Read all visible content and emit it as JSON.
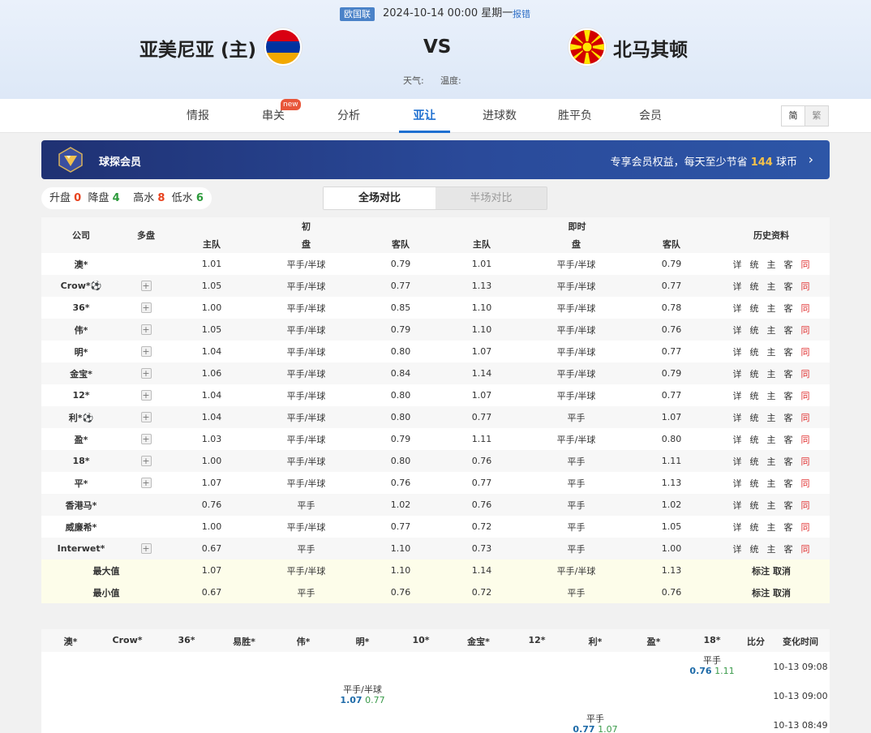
{
  "match": {
    "league": "欧国联",
    "datetime": "2024-10-14 00:00 星期一",
    "report_link": "报错",
    "home_team": "亚美尼亚 (主)",
    "away_team": "北马其顿",
    "vs": "VS",
    "weather_label": "天气:",
    "temp_label": "温度:"
  },
  "nav": {
    "tabs": [
      "情报",
      "串关",
      "分析",
      "亚让",
      "进球数",
      "胜平负",
      "会员"
    ],
    "active_tab": "亚让",
    "new_badge": "new",
    "lang_simplified": "简",
    "lang_traditional": "繁"
  },
  "banner": {
    "title": "球探会员",
    "promo_prefix": "专享会员权益，每天至少节省 ",
    "promo_number": "144",
    "promo_suffix": " 球币",
    "arrow": "›"
  },
  "stats": {
    "up_label": "升盘",
    "up": "0",
    "down_label": "降盘",
    "down": "4",
    "high_label": "高水",
    "high": "8",
    "low_label": "低水",
    "low": "6"
  },
  "toggle": {
    "full": "全场对比",
    "half": "半场对比"
  },
  "odds_table": {
    "headers": {
      "company": "公司",
      "multi": "多盘",
      "initial": "初",
      "live": "即时",
      "history": "历史资料",
      "home": "主队",
      "line": "盘",
      "away": "客队"
    },
    "history_links": [
      "详",
      "统",
      "主",
      "客",
      "同"
    ],
    "rows": [
      {
        "company": "澳*",
        "multi": false,
        "i_home": "1.01",
        "i_line": "平手/半球",
        "i_away": "0.79",
        "l_home": "1.01",
        "l_line": "平手/半球",
        "l_away": "0.79"
      },
      {
        "company": "Crow*⚽",
        "multi": true,
        "i_home": "1.05",
        "i_line": "平手/半球",
        "i_away": "0.77",
        "l_home": "1.13",
        "l_line": "平手/半球",
        "l_away": "0.77"
      },
      {
        "company": "36*",
        "multi": true,
        "i_home": "1.00",
        "i_line": "平手/半球",
        "i_away": "0.85",
        "l_home": "1.10",
        "l_line": "平手/半球",
        "l_away": "0.78"
      },
      {
        "company": "伟*",
        "multi": true,
        "i_home": "1.05",
        "i_line": "平手/半球",
        "i_away": "0.79",
        "l_home": "1.10",
        "l_line": "平手/半球",
        "l_away": "0.76"
      },
      {
        "company": "明*",
        "multi": true,
        "i_home": "1.04",
        "i_line": "平手/半球",
        "i_away": "0.80",
        "l_home": "1.07",
        "l_line": "平手/半球",
        "l_away": "0.77"
      },
      {
        "company": "金宝*",
        "multi": true,
        "i_home": "1.06",
        "i_line": "平手/半球",
        "i_away": "0.84",
        "l_home": "1.14",
        "l_line": "平手/半球",
        "l_away": "0.79"
      },
      {
        "company": "12*",
        "multi": true,
        "i_home": "1.04",
        "i_line": "平手/半球",
        "i_away": "0.80",
        "l_home": "1.07",
        "l_line": "平手/半球",
        "l_away": "0.77"
      },
      {
        "company": "利*⚽",
        "multi": true,
        "i_home": "1.04",
        "i_line": "平手/半球",
        "i_away": "0.80",
        "l_home": "0.77",
        "l_line": "平手",
        "l_away": "1.07"
      },
      {
        "company": "盈*",
        "multi": true,
        "i_home": "1.03",
        "i_line": "平手/半球",
        "i_away": "0.79",
        "l_home": "1.11",
        "l_line": "平手/半球",
        "l_away": "0.80"
      },
      {
        "company": "18*",
        "multi": true,
        "i_home": "1.00",
        "i_line": "平手/半球",
        "i_away": "0.80",
        "l_home": "0.76",
        "l_line": "平手",
        "l_away": "1.11"
      },
      {
        "company": "平*",
        "multi": true,
        "i_home": "1.07",
        "i_line": "平手/半球",
        "i_away": "0.76",
        "l_home": "0.77",
        "l_line": "平手",
        "l_away": "1.13"
      },
      {
        "company": "香港马*",
        "multi": false,
        "i_home": "0.76",
        "i_line": "平手",
        "i_away": "1.02",
        "l_home": "0.76",
        "l_line": "平手",
        "l_away": "1.02"
      },
      {
        "company": "威廉希*",
        "multi": false,
        "i_home": "1.00",
        "i_line": "平手/半球",
        "i_away": "0.77",
        "l_home": "0.72",
        "l_line": "平手",
        "l_away": "1.05"
      },
      {
        "company": "Interwet*",
        "multi": true,
        "i_home": "0.67",
        "i_line": "平手",
        "i_away": "1.10",
        "l_home": "0.73",
        "l_line": "平手",
        "l_away": "1.00"
      }
    ],
    "summary": [
      {
        "label": "最大值",
        "i_home": "1.07",
        "i_line": "平手/半球",
        "i_away": "1.10",
        "l_home": "1.14",
        "l_line": "平手/半球",
        "l_away": "1.13",
        "opt1": "标注",
        "opt2": "取消"
      },
      {
        "label": "最小值",
        "i_home": "0.67",
        "i_line": "平手",
        "i_away": "0.76",
        "l_home": "0.72",
        "l_line": "平手",
        "l_away": "0.76",
        "opt1": "标注",
        "opt2": "取消"
      }
    ]
  },
  "change_table": {
    "headers": [
      "澳*",
      "Crow*",
      "36*",
      "易胜*",
      "伟*",
      "明*",
      "10*",
      "金宝*",
      "12*",
      "利*",
      "盈*",
      "18*",
      "比分",
      "变化时间"
    ],
    "rows": [
      {
        "company_index": 11,
        "line": "平手",
        "a": "0.76",
        "b": "1.11",
        "time": "10-13 09:08"
      },
      {
        "company_index": 5,
        "line": "平手/半球",
        "a": "1.07",
        "b": "0.77",
        "time": "10-13 09:00"
      },
      {
        "company_index": 9,
        "line": "平手",
        "a": "0.77",
        "b": "1.07",
        "time": "10-13 08:49"
      }
    ]
  }
}
